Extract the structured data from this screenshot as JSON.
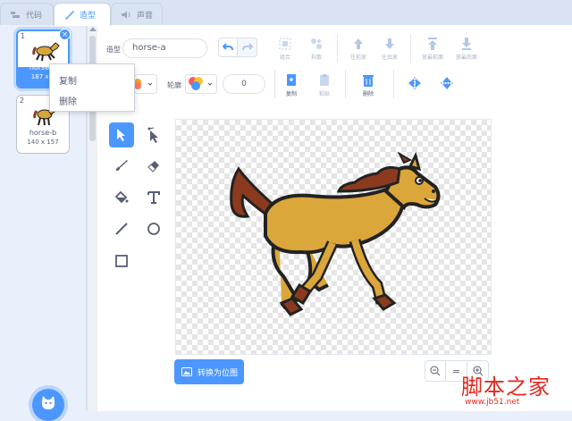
{
  "tabs": [
    {
      "label": "代码",
      "icon": "code-icon"
    },
    {
      "label": "造型",
      "icon": "brush-icon"
    },
    {
      "label": "声音",
      "icon": "speaker-icon"
    }
  ],
  "costumes": [
    {
      "number": "1",
      "name": "horse-a",
      "size": "187 x 1",
      "selected": true
    },
    {
      "number": "2",
      "name": "horse-b",
      "size": "140 x 157",
      "selected": false
    }
  ],
  "context_menu": {
    "items": [
      "复制",
      "删除"
    ]
  },
  "toolbar": {
    "costume_label": "造型",
    "costume_name": "horse-a",
    "group": "组合",
    "ungroup": "拆散",
    "forward": "往前放",
    "backward": "往后放",
    "front": "放最前面",
    "back": "放最后面",
    "outline_label": "轮廓",
    "outline_width": "0",
    "copy": "复制",
    "paste": "粘贴",
    "delete": "删除"
  },
  "convert_button": "转换为位图",
  "zoom": {
    "reset": "="
  },
  "watermark": {
    "title": "脚本之家",
    "url": "www.jb51.net"
  },
  "colors": {
    "accent": "#4c97ff",
    "watermark": "#e3281e",
    "horse_body": "#dba73a",
    "horse_mane": "#8b3a1e"
  }
}
